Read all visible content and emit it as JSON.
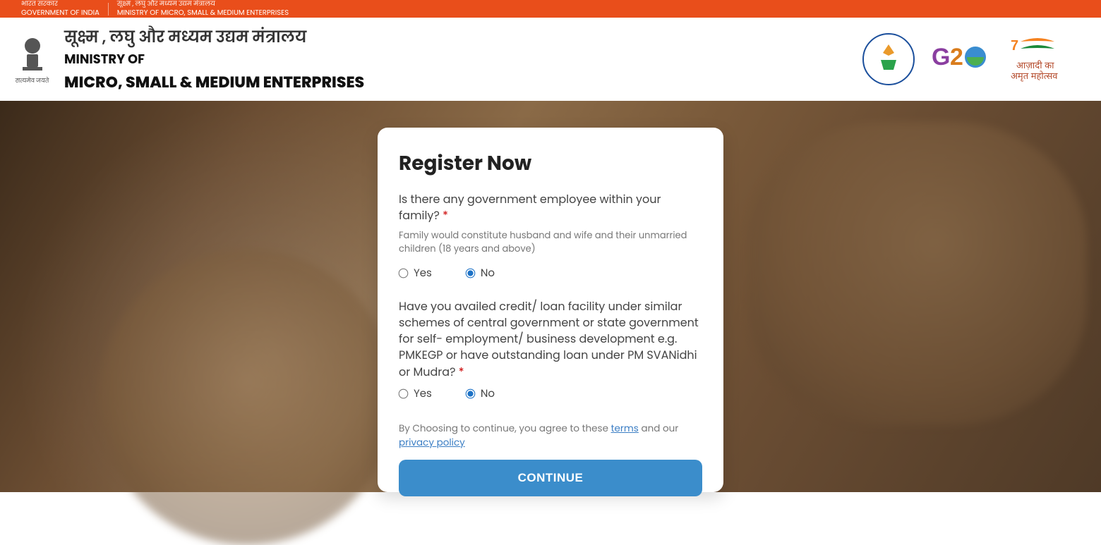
{
  "topbar": {
    "gov_hi": "भारत सरकार",
    "gov_en": "GOVERNMENT OF INDIA",
    "min_hi": "सूक्ष्म , लघु और मध्यम उद्यम मंत्रालय",
    "min_en": "MINISTRY OF MICRO, SMALL & MEDIUM ENTERPRISES"
  },
  "header": {
    "emblem_motto": "सत्यमेव जयते",
    "title_hi": "सूक्ष्म , लघु और मध्यम उद्यम मंत्रालय",
    "title_en_line1": "MINISTRY OF",
    "title_en_line2": "MICRO, SMALL & MEDIUM ENTERPRISES",
    "logos": {
      "vishwakarma": "PM Vishwakarma",
      "g20": "G20",
      "azadi": "आज़ादी का अमृत महोत्सव"
    }
  },
  "form": {
    "heading": "Register Now",
    "q1": "Is there any government employee within your family?",
    "q1_hint": "Family would constitute husband and wife and their unmarried children (18 years and above)",
    "q2": "Have you availed credit/ loan facility under similar schemes of central government or state government for self- employment/ business development e.g. PMKEGP or have outstanding loan under PM SVANidhi or Mudra?",
    "yes": "Yes",
    "no": "No",
    "q1_selected": "No",
    "q2_selected": "No",
    "consent_prefix": "By Choosing to continue, you agree to these ",
    "terms": "terms",
    "consent_mid": " and our ",
    "privacy": "privacy policy",
    "continue": "CONTINUE"
  }
}
